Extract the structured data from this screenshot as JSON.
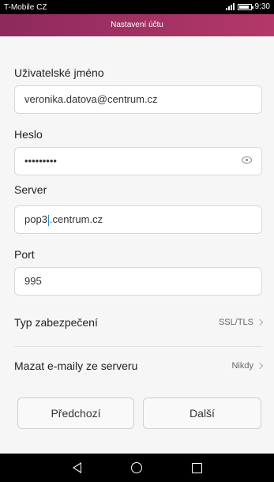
{
  "status_bar": {
    "carrier": "T-Mobile CZ",
    "time": "9:30",
    "signal_icon": "signal-icon",
    "battery_icon": "battery-icon"
  },
  "header": {
    "title": "Nastavení účtu"
  },
  "form": {
    "username_label": "Uživatelské jméno",
    "username_value": "veronika.datova@centrum.cz",
    "password_label": "Heslo",
    "password_value": "•••••••••",
    "server_label": "Server",
    "server_value_before_cursor": "pop3",
    "server_value_after_cursor": ".centrum.cz",
    "port_label": "Port",
    "port_value": "995"
  },
  "settings": {
    "security_label": "Typ zabezpečení",
    "security_value": "SSL/TLS",
    "delete_label": "Mazat e-maily ze serveru",
    "delete_value": "Nikdy"
  },
  "buttons": {
    "previous": "Předchozí",
    "next": "Další"
  },
  "nav": {
    "back_icon": "back-icon",
    "home_icon": "home-icon",
    "recent_icon": "recent-apps-icon"
  }
}
